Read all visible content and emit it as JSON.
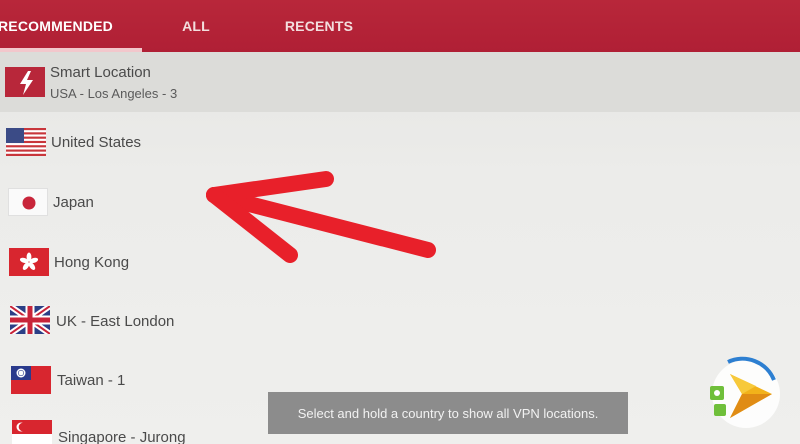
{
  "tabs": [
    {
      "label": "RECOMMENDED",
      "active": true
    },
    {
      "label": "ALL",
      "active": false
    },
    {
      "label": "RECENTS",
      "active": false
    }
  ],
  "smart_location": {
    "title": "Smart Location",
    "subtitle": "USA - Los Angeles - 3",
    "icon": "lightning-icon"
  },
  "locations": [
    {
      "label": "United States",
      "flag": "us-flag-icon"
    },
    {
      "label": "Japan",
      "flag": "japan-flag-icon"
    },
    {
      "label": "Hong Kong",
      "flag": "hongkong-flag-icon"
    },
    {
      "label": "UK - East London",
      "flag": "uk-flag-icon"
    },
    {
      "label": "Taiwan - 1",
      "flag": "taiwan-flag-icon"
    },
    {
      "label": "Singapore - Jurong",
      "flag": "singapore-flag-icon"
    }
  ],
  "toast": "Select and hold a country to show all VPN locations.",
  "colors": {
    "brand_red": "#b01f35",
    "arrow_red": "#e8202a",
    "background": "#ececea",
    "toast_bg": "#8c8c8c"
  }
}
